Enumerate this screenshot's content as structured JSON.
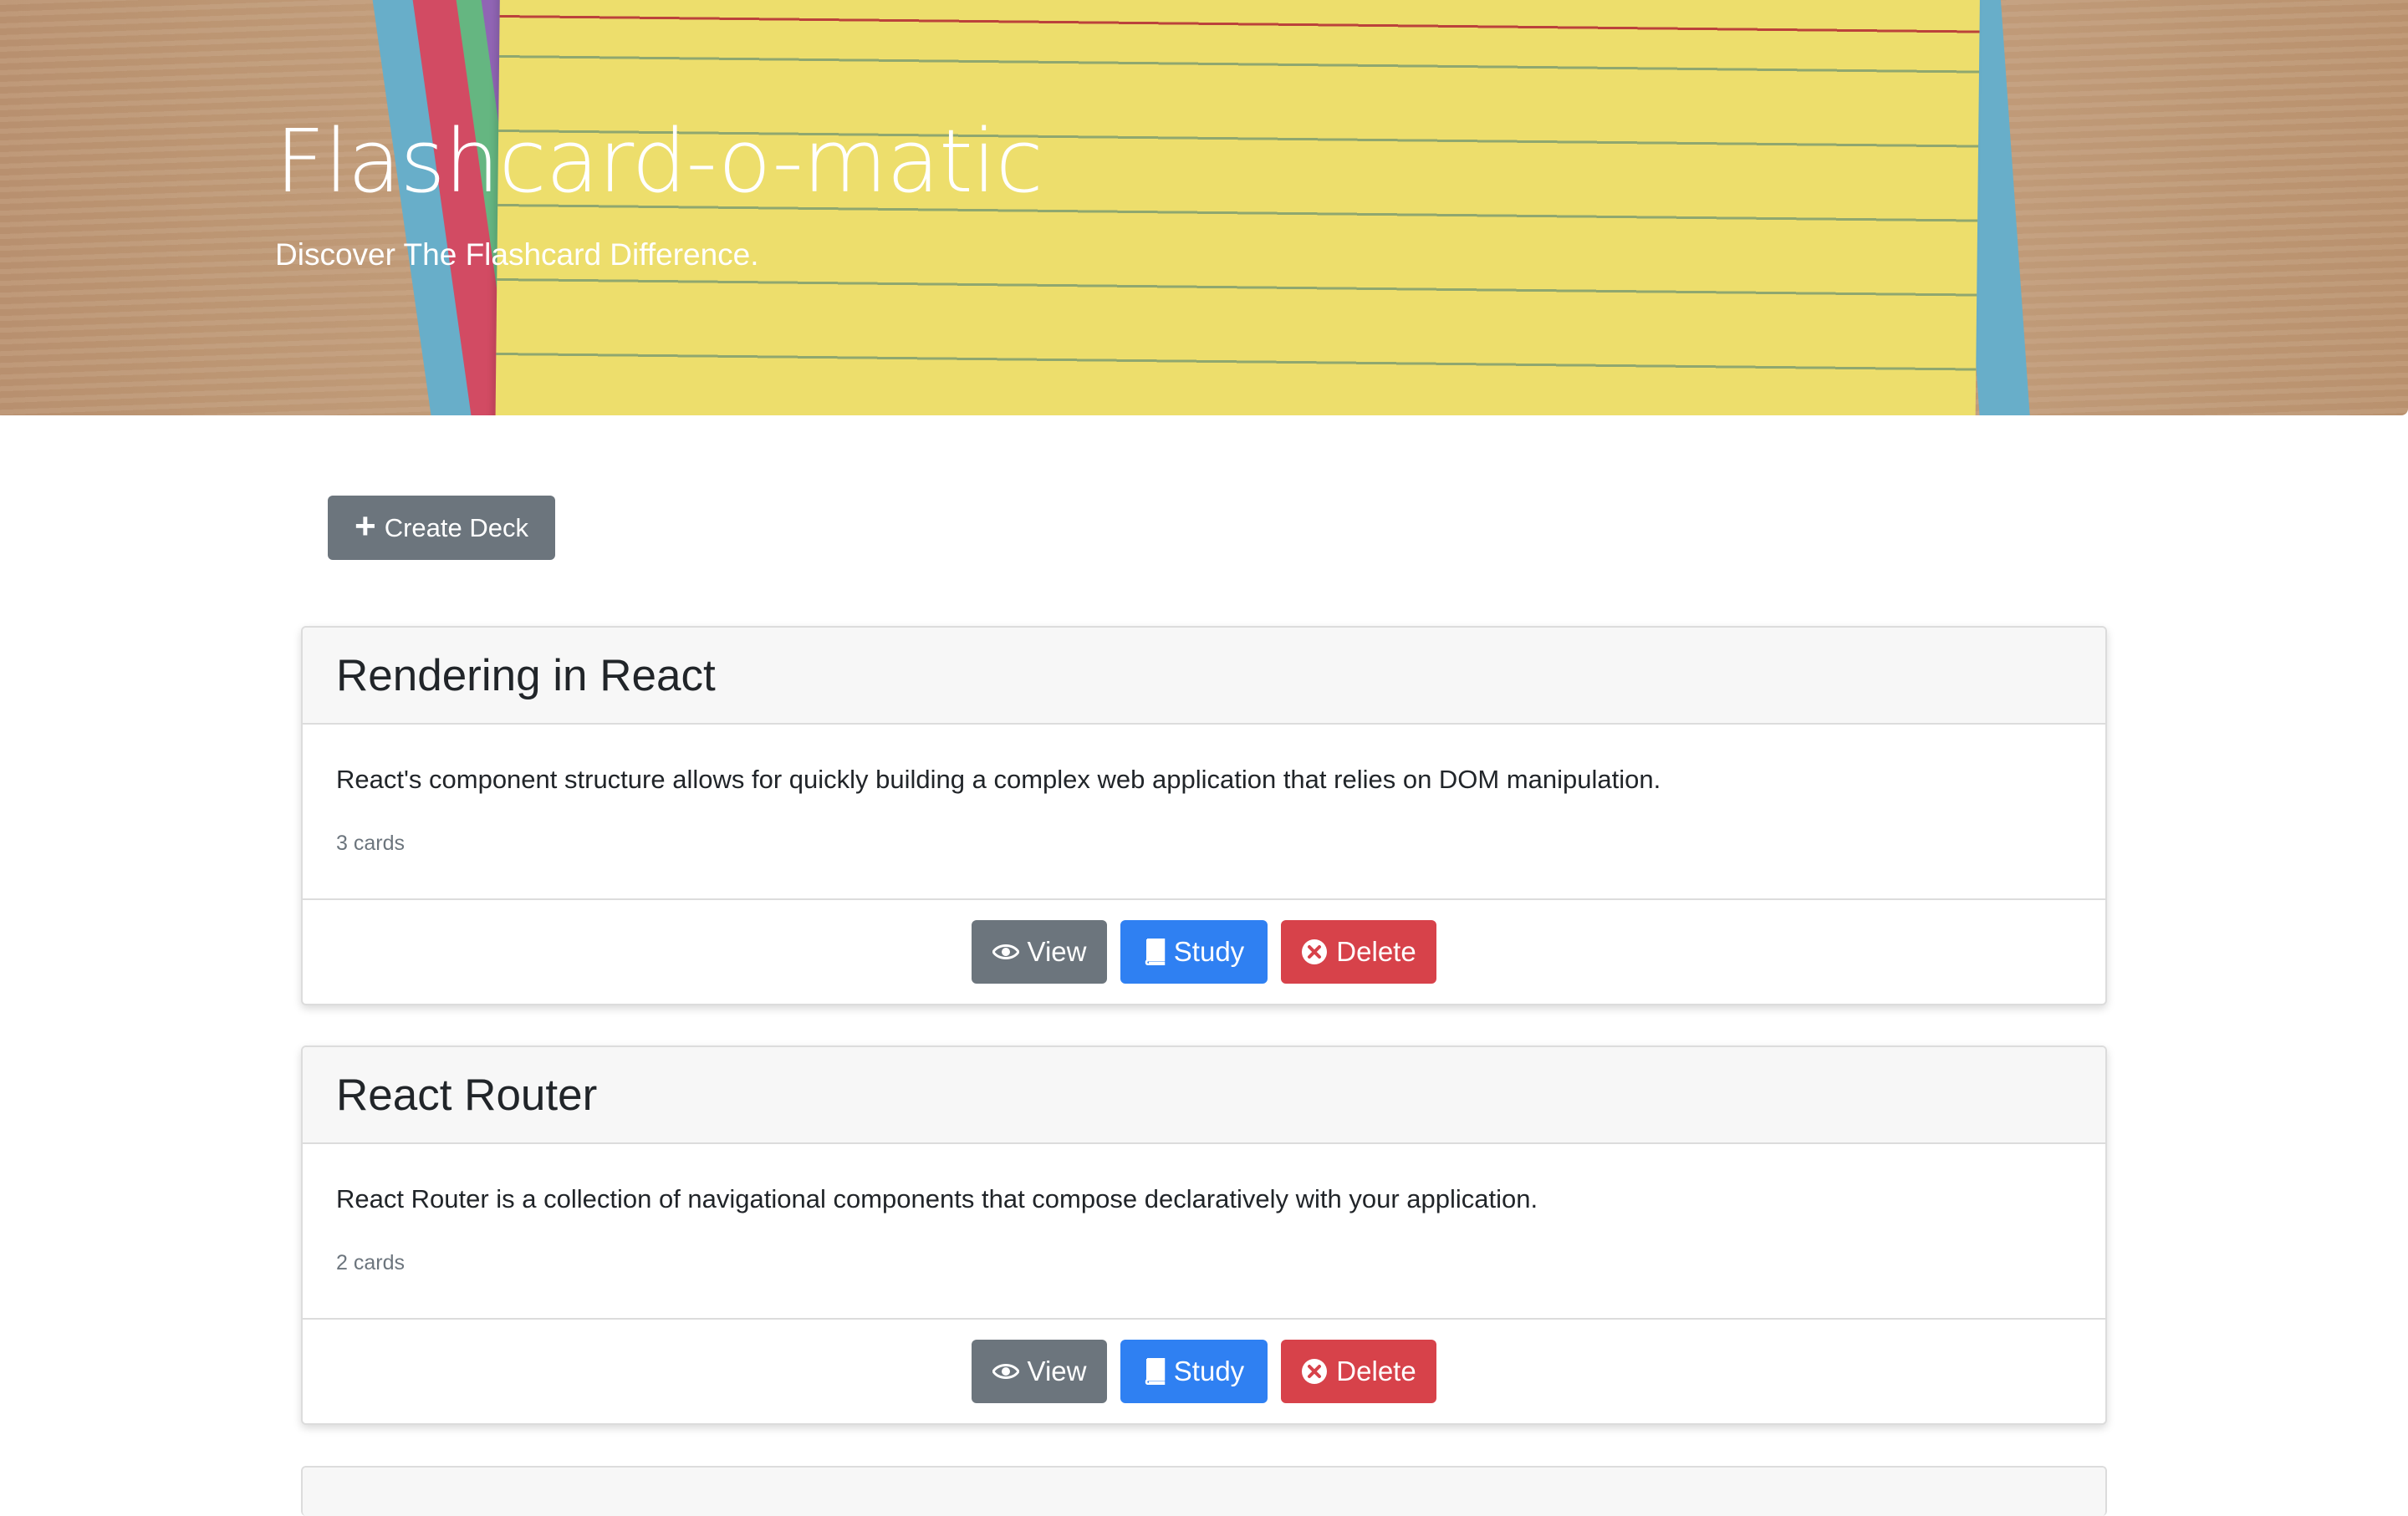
{
  "hero": {
    "title": "Flashcard-o-matic",
    "subtitle": "Discover The Flashcard Difference."
  },
  "toolbar": {
    "create_label": "Create Deck",
    "create_icon": "plus-icon"
  },
  "decks": [
    {
      "title": "Rendering in React",
      "description": "React's component structure allows for quickly building a complex web application that relies on DOM manipulation.",
      "count": "3 cards",
      "actions": {
        "view": "View",
        "study": "Study",
        "delete": "Delete"
      }
    },
    {
      "title": "React Router",
      "description": "React Router is a collection of navigational components that compose declaratively with your application.",
      "count": "2 cards",
      "actions": {
        "view": "View",
        "study": "Study",
        "delete": "Delete"
      }
    }
  ],
  "icons": {
    "view": "eye-icon",
    "study": "book-icon",
    "delete": "x-circle-icon"
  },
  "colors": {
    "secondary": "#6c757d",
    "primary": "#2f80f2",
    "danger": "#d7424a",
    "card_header_bg": "#f7f7f7"
  }
}
